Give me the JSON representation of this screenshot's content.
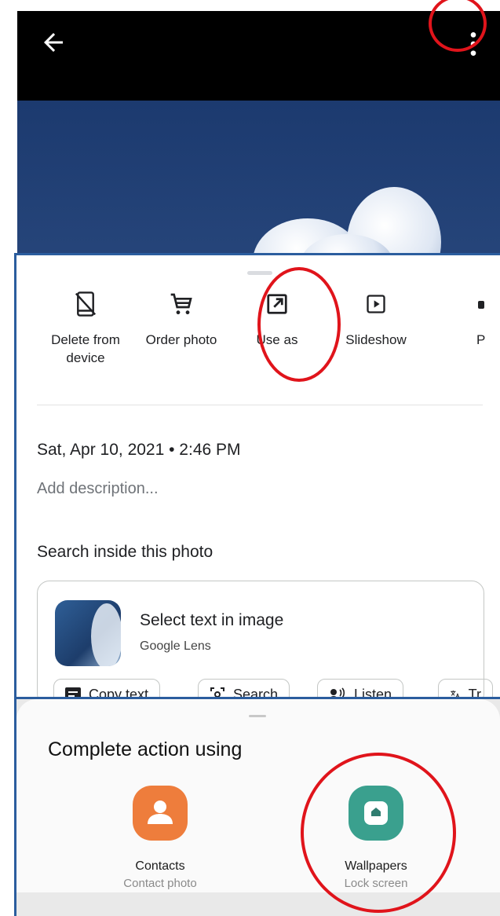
{
  "viewer": {
    "back_icon": "arrow-left-icon",
    "more_icon": "more-vert-icon"
  },
  "actions": [
    {
      "label": "Delete from device",
      "icon": "phone-delete-icon"
    },
    {
      "label": "Order photo",
      "icon": "cart-icon"
    },
    {
      "label": "Use as",
      "icon": "open-external-icon"
    },
    {
      "label": "Slideshow",
      "icon": "slideshow-icon"
    },
    {
      "label": "P",
      "icon": "partial-icon"
    }
  ],
  "details": {
    "date": "Sat, Apr 10, 2021 • 2:46 PM",
    "description_placeholder": "Add description...",
    "search_title": "Search inside this photo",
    "lens_title": "Select text in image",
    "lens_subtitle": "Google Lens",
    "chips": [
      "Copy text",
      "Search",
      "Listen",
      "Tr"
    ]
  },
  "sheet": {
    "title": "Complete action using",
    "apps": [
      {
        "name": "Contacts",
        "subtitle": "Contact photo",
        "color": "#ee7d3c",
        "icon": "contacts-icon"
      },
      {
        "name": "Wallpapers",
        "subtitle": "Lock screen",
        "color": "#3aa08e",
        "icon": "wallpapers-icon"
      }
    ]
  },
  "colors": {
    "highlight_ring": "#e0141b",
    "frame_border": "#2b5d9e"
  }
}
